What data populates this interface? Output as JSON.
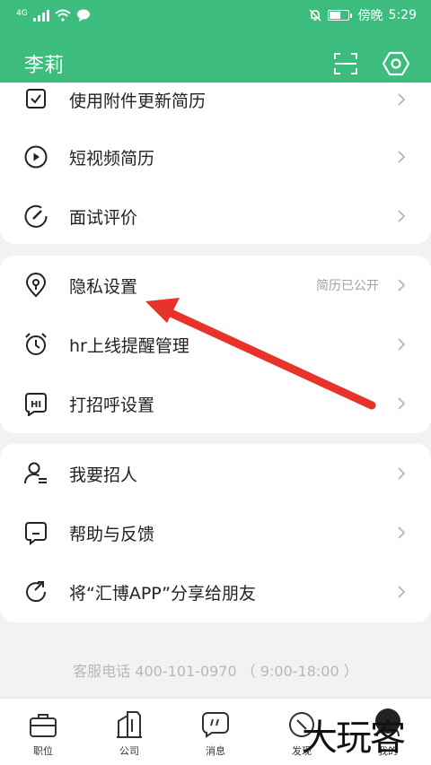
{
  "status_bar": {
    "network": "4G",
    "carrier": "傍晚",
    "time": "5:29"
  },
  "header": {
    "title": "李莉",
    "scan_icon": "scan-icon",
    "settings_icon": "settings-icon"
  },
  "card1": {
    "items": [
      {
        "label": "使用附件更新简历",
        "icon": "document-icon"
      },
      {
        "label": "短视频简历",
        "icon": "play-circle-icon"
      },
      {
        "label": "面试评价",
        "icon": "rating-icon"
      }
    ]
  },
  "card2": {
    "items": [
      {
        "label": "隐私设置",
        "value": "简历已公开",
        "icon": "location-shield-icon"
      },
      {
        "label": "hr上线提醒管理",
        "icon": "alarm-clock-icon"
      },
      {
        "label": "打招呼设置",
        "icon": "hi-bubble-icon"
      }
    ]
  },
  "card3": {
    "items": [
      {
        "label": "我要招人",
        "icon": "recruit-person-icon"
      },
      {
        "label": "帮助与反馈",
        "icon": "feedback-icon"
      },
      {
        "label": "将“汇博APP”分享给朋友",
        "icon": "share-icon"
      }
    ]
  },
  "hotline": "客服电话 400-101-0970 （ 9:00-18:00 ）",
  "bottom_nav": [
    {
      "label": "职位",
      "icon": "briefcase-icon"
    },
    {
      "label": "公司",
      "icon": "building-icon"
    },
    {
      "label": "消息",
      "icon": "message-icon"
    },
    {
      "label": "发现",
      "icon": "discover-icon"
    },
    {
      "label": "我的",
      "icon": "profile-icon"
    }
  ],
  "watermark": "大玩客",
  "colors": {
    "brand_green": "#3dbd7d",
    "annotation_red": "#e8332a"
  }
}
